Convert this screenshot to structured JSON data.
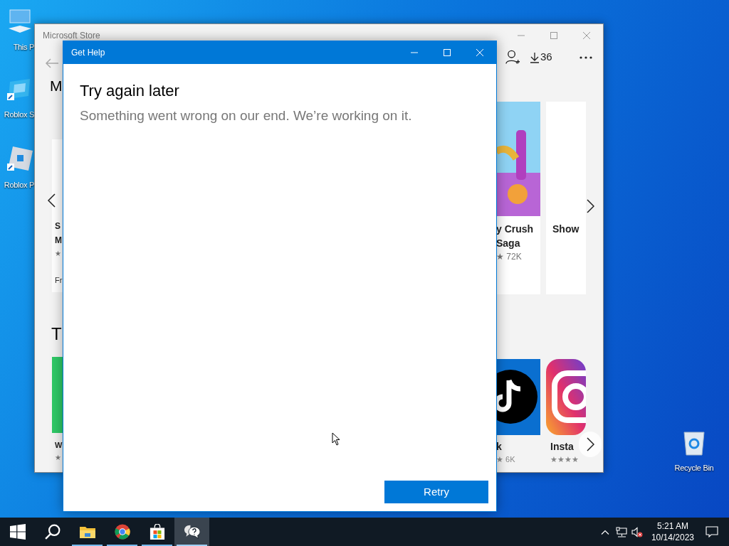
{
  "desktop_icons": [
    {
      "label": "This P",
      "kind": "pc"
    },
    {
      "label": "Roblox S",
      "kind": "studio"
    },
    {
      "label": "Roblox P",
      "kind": "player"
    },
    {
      "label": "Recycle Bin",
      "kind": "bin"
    }
  ],
  "store_window": {
    "title": "Microsoft Store",
    "downloads": "36",
    "left_column": {
      "heading": "M",
      "card_lines": [
        "S",
        "M"
      ],
      "card_rating": "★",
      "card_price": "Fr",
      "heading_2": "T",
      "card_2_line": "W",
      "card_2_rating": "★"
    },
    "apps": [
      {
        "kind": "candy",
        "lines": [
          "y Crush",
          "Saga"
        ],
        "rating": "★ 72K"
      },
      {
        "kind": "more",
        "lines": [
          "Show"
        ]
      }
    ],
    "apps_2": [
      {
        "kind": "tiktok",
        "lines": [
          "k"
        ],
        "rating": "★ 6K"
      },
      {
        "kind": "instagram",
        "lines": [
          "Insta"
        ],
        "rating": "★★★★"
      }
    ]
  },
  "dialog": {
    "title": "Get Help",
    "heading": "Try again later",
    "message": "Something went wrong on our end. We’re working on it.",
    "button": "Retry"
  },
  "taskbar": {
    "apps": [
      {
        "kind": "start",
        "running": false,
        "active": false
      },
      {
        "kind": "search",
        "running": false,
        "active": false
      },
      {
        "kind": "explorer",
        "running": true,
        "active": false
      },
      {
        "kind": "chrome",
        "running": true,
        "active": false
      },
      {
        "kind": "store",
        "running": true,
        "active": false
      },
      {
        "kind": "help",
        "running": true,
        "active": true
      }
    ],
    "tray": {
      "time": "5:21 AM",
      "date": "10/14/2023"
    }
  }
}
